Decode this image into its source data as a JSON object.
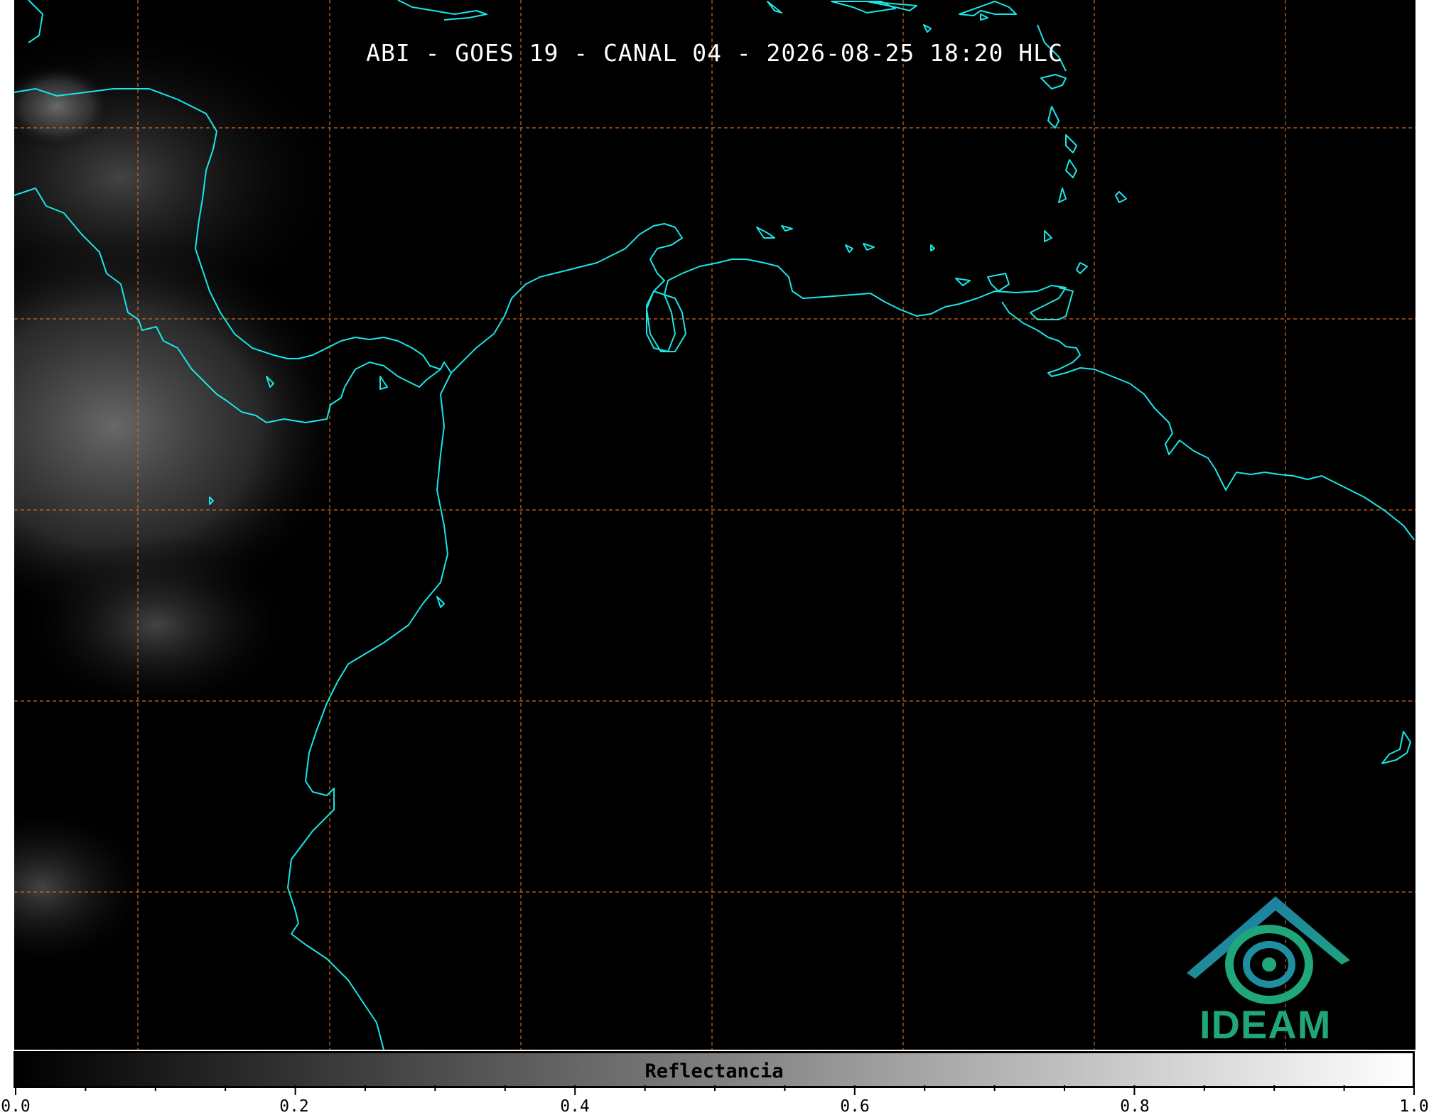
{
  "title": "ABI - GOES 19 - CANAL 04 - 2026-08-25 18:20 HLC",
  "colorbar": {
    "label": "Reflectancia",
    "range": [
      0.0,
      1.0
    ],
    "colors": [
      "#000000",
      "#ffffff"
    ],
    "ticks": [
      "0.0",
      "0.2",
      "0.4",
      "0.6",
      "0.8",
      "1.0"
    ]
  },
  "map": {
    "coastline_color": "#19e6e6",
    "gridline_color": "#d2691e",
    "background_color": "#000000"
  },
  "logo": {
    "text": "IDEAM",
    "colors": [
      "#1e73b4",
      "#1fa67a"
    ]
  }
}
